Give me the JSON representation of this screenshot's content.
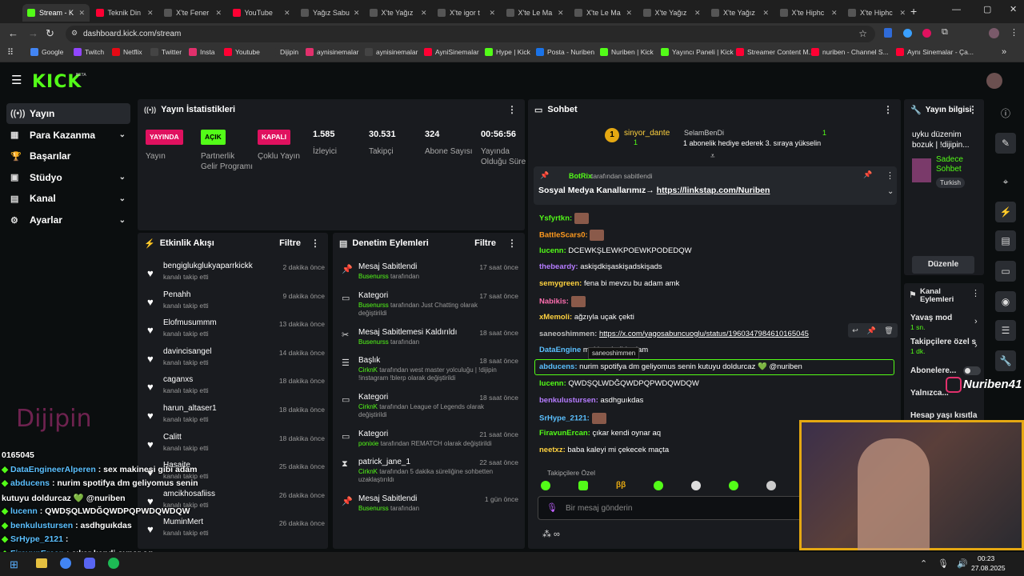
{
  "browser": {
    "tabs": [
      {
        "label": "Stream - K",
        "color": "#53fc18",
        "active": true
      },
      {
        "label": "Teknik Din",
        "color": "#ff0033"
      },
      {
        "label": "X'te Fener",
        "color": "#555"
      },
      {
        "label": "YouTube",
        "color": "#ff0033"
      },
      {
        "label": "Yağız Sabu",
        "color": "#555"
      },
      {
        "label": "X'te Yağız",
        "color": "#555"
      },
      {
        "label": "X'te igor t",
        "color": "#555"
      },
      {
        "label": "X'te Le Ma",
        "color": "#555"
      },
      {
        "label": "X'te Le Ma",
        "color": "#555"
      },
      {
        "label": "X'te Yağız",
        "color": "#555"
      },
      {
        "label": "X'te Yağız",
        "color": "#555"
      },
      {
        "label": "X'te Hiphc",
        "color": "#555"
      },
      {
        "label": "X'te Hiphc",
        "color": "#555"
      }
    ],
    "url": "dashboard.kick.com/stream",
    "bookmarks": [
      {
        "label": "Google",
        "color": "#4285f4"
      },
      {
        "label": "Twitch",
        "color": "#9146ff"
      },
      {
        "label": "Netflix",
        "color": "#e50914"
      },
      {
        "label": "Twitter",
        "color": "#444"
      },
      {
        "label": "Insta",
        "color": "#e1306c"
      },
      {
        "label": "Youtube",
        "color": "#ff0033"
      },
      {
        "label": "Dijipin",
        "color": "#333"
      },
      {
        "label": "aynisinemalar",
        "color": "#e1306c"
      },
      {
        "label": "aynisinemalar",
        "color": "#444"
      },
      {
        "label": "AyniSinemalar",
        "color": "#ff0033"
      },
      {
        "label": "Hype | Kick",
        "color": "#53fc18"
      },
      {
        "label": "Posta - Nuriben",
        "color": "#1a73e8"
      },
      {
        "label": "Nuriben | Kick",
        "color": "#53fc18"
      },
      {
        "label": "Yayıncı Paneli | Kick",
        "color": "#53fc18"
      },
      {
        "label": "Streamer Content M...",
        "color": "#ff0033"
      },
      {
        "label": "nuriben - Channel S...",
        "color": "#ff0033"
      },
      {
        "label": "Aynı Sinemalar - Ça...",
        "color": "#ff0033"
      }
    ]
  },
  "app": {
    "logo": "KICK",
    "beta": "BETA"
  },
  "sidebar": [
    {
      "label": "Yayın",
      "icon": "((•))",
      "chev": ""
    },
    {
      "label": "Para Kazanma",
      "icon": "▦",
      "chev": "⌄"
    },
    {
      "label": "Başarılar",
      "icon": "🏆",
      "chev": ""
    },
    {
      "label": "Stüdyo",
      "icon": "▣",
      "chev": "⌄"
    },
    {
      "label": "Kanal",
      "icon": "▤",
      "chev": "⌄"
    },
    {
      "label": "Ayarlar",
      "icon": "⚙",
      "chev": "⌄"
    }
  ],
  "stats": {
    "title": "Yayın İstatistikleri",
    "items": [
      {
        "badge": "YAYINDA",
        "badge_color": "#e0115f",
        "label": "Yayın"
      },
      {
        "badge": "AÇIK",
        "badge_color": "#53fc18",
        "label": "Partnerlik Gelir Programı"
      },
      {
        "badge": "KAPALI",
        "badge_color": "#e0115f",
        "label": "Çoklu Yayın"
      },
      {
        "num": "1.585",
        "label": "İzleyici"
      },
      {
        "num": "30.531",
        "label": "Takipçi"
      },
      {
        "num": "324",
        "label": "Abone Sayısı"
      },
      {
        "num": "00:56:56",
        "label": "Yayında Olduğu Süre"
      }
    ]
  },
  "events": {
    "title": "Etkinlik Akışı",
    "filter": "Filtre",
    "items": [
      {
        "name": "bengiglukglukyaparrkickk",
        "sub": "kanalı takip etti",
        "time": "2 dakika önce"
      },
      {
        "name": "Penahh",
        "sub": "kanalı takip etti",
        "time": "9 dakika önce"
      },
      {
        "name": "Elofmusummm",
        "sub": "kanalı takip etti",
        "time": "13 dakika önce"
      },
      {
        "name": "davincisangel",
        "sub": "kanalı takip etti",
        "time": "14 dakika önce"
      },
      {
        "name": "caganxs",
        "sub": "kanalı takip etti",
        "time": "18 dakika önce"
      },
      {
        "name": "harun_altaser1",
        "sub": "kanalı takip etti",
        "time": "18 dakika önce"
      },
      {
        "name": "Calitt",
        "sub": "kanalı takip etti",
        "time": "18 dakika önce"
      },
      {
        "name": "Hasaite",
        "sub": "kanalı takip etti",
        "time": "25 dakika önce"
      },
      {
        "name": "amcikhosafiiss",
        "sub": "kanalı takip etti",
        "time": "26 dakika önce"
      },
      {
        "name": "MuminMert",
        "sub": "kanalı takip etti",
        "time": "26 dakika önce"
      }
    ]
  },
  "moderation": {
    "title": "Denetim Eylemleri",
    "filter": "Filtre",
    "items": [
      {
        "icon": "📌",
        "title": "Mesaj Sabitlendi",
        "time": "17 saat önce",
        "user": "Busenurss",
        "desc": "tarafından"
      },
      {
        "icon": "▭",
        "title": "Kategori",
        "time": "17 saat önce",
        "user": "Busenurss",
        "desc": "tarafından Just Chatting olarak değiştirildi"
      },
      {
        "icon": "✂",
        "title": "Mesaj Sabitlemesi Kaldırıldı",
        "time": "18 saat önce",
        "user": "Busenurss",
        "desc": "tarafından"
      },
      {
        "icon": "☰",
        "title": "Başlık",
        "time": "18 saat önce",
        "user": "CirknK",
        "desc": "tarafından west master yolculuğu | !dijipin !instagram !blerp olarak değiştirildi"
      },
      {
        "icon": "▭",
        "title": "Kategori",
        "time": "18 saat önce",
        "user": "CirknK",
        "desc": "tarafından League of Legends olarak değiştirildi"
      },
      {
        "icon": "▭",
        "title": "Kategori",
        "time": "21 saat önce",
        "user": "ponixie",
        "desc": "tarafından REMATCH olarak değiştirildi"
      },
      {
        "icon": "⧗",
        "title": "patrick_jane_1",
        "time": "22 saat önce",
        "user": "CirknK",
        "desc": "tarafından 5 dakika süreliğine sohbetten uzaklaştırıldı"
      },
      {
        "icon": "📌",
        "title": "Mesaj Sabitlendi",
        "time": "1 gün önce",
        "user": "Busenurss",
        "desc": "tarafından"
      }
    ]
  },
  "chat": {
    "title": "Sohbet",
    "gift_user": "sinyor_dante",
    "gift_count": "1",
    "gift_user2": "SelamBenDi",
    "gift_count2": "1",
    "gift_text": "1 abonelik hediye ederek 3. sıraya yükselin",
    "pinned_by": "BotRix",
    "pinned_by_suffix": "tarafından sabitlendi",
    "pinned_text": "Sosyal Medya Kanallarımız→ ",
    "pinned_link": "https://linkstap.com/Nuriben",
    "messages": [
      {
        "user": "Ysfyrtkn:",
        "color": "#53fc18",
        "text": "",
        "emote": true
      },
      {
        "user": "BattleScars0:",
        "color": "#ff9a1f",
        "text": "",
        "emote": true
      },
      {
        "user": "lucenn:",
        "color": "#53fc18",
        "text": "DCEWKŞLEWKPOEWKPODEDQW"
      },
      {
        "user": "thebeardy:",
        "color": "#b57cff",
        "text": "askişdkişaskişadskişads"
      },
      {
        "user": "semygreen:",
        "color": "#ffd23f",
        "text": "fena bi mevzu bu adam amk"
      },
      {
        "user": "Nabikis:",
        "color": "#ff6fb0",
        "text": "",
        "emote": true
      },
      {
        "user": "xMemoli:",
        "color": "#ffd23f",
        "text": "ağzıyla uçak çekti"
      },
      {
        "user": "saneoshimmen:",
        "color": "#bbb",
        "text": "https://x.com/yagosabuncuoglu/status/1960347984610165045"
      },
      {
        "user": "DataEngine",
        "color": "#5bc0ff",
        "text": "makinesi gibi adam"
      },
      {
        "user": "abducens:",
        "color": "#5bc0ff",
        "text": "nurim spotifya dm geliyomus senin kutuyu doldurcaz 💚 @nuriben"
      },
      {
        "user": "lucenn:",
        "color": "#53fc18",
        "text": "QWDŞQLWDĞQWDPQPWDQWDQW"
      },
      {
        "user": "benkulustursen:",
        "color": "#b57cff",
        "text": "asdhguıkdas"
      },
      {
        "user": "SrHype_2121:",
        "color": "#5bc0ff",
        "text": "",
        "emote": true
      },
      {
        "user": "FiravunErcan:",
        "color": "#53fc18",
        "text": "çıkar kendi oynar aq"
      },
      {
        "user": "neetxz:",
        "color": "#ffd23f",
        "text": "baba kaleyi mi çekecek maçta"
      }
    ],
    "tooltip": "saneoshimmen",
    "followers_label": "Takipçilere Özel",
    "input_placeholder": "Bir mesaj gönderin"
  },
  "streaminfo": {
    "title": "Yayın bilgisi",
    "stream_title": "uyku düzenim bozuk | !dijipin...",
    "category": "Sadece Sohbet",
    "lang": "Turkish",
    "edit": "Düzenle"
  },
  "channel_actions": {
    "title": "Kanal Eylemleri",
    "slow": "Yavaş mod",
    "slow_val": "1 sn.",
    "followers": "Takipçilere özel s",
    "followers_val": "1 dk.",
    "subs": "Abonelere...",
    "only": "Yalnızca...",
    "age": "Hesap yaşı kısıtla"
  },
  "overlay": {
    "brand": "Dijipin",
    "handle": "Nuriben41",
    "lines": [
      {
        "user": "",
        "text": "0165045"
      },
      {
        "user": "DataEngineerAlperen",
        "text": ": sex makinesi gibi adam"
      },
      {
        "user": "abducens",
        "text": ": nurim spotifya dm geliyomus senin"
      },
      {
        "user": "",
        "text": "kutuyu doldurcaz 💚 @nuriben"
      },
      {
        "user": "lucenn",
        "text": ": QWDŞQLWDĞQWDPQPWDQWDQW"
      },
      {
        "user": "benkulustursen",
        "text": ": asdhguıkdas"
      },
      {
        "user": "SrHype_2121",
        "text": ":"
      },
      {
        "user": "FiravunErcan",
        "text": ": çıkar kendi oynar aq"
      },
      {
        "user": "neetxz",
        "text": ": baba kaleyi mi çekecek maçta"
      }
    ]
  },
  "taskbar": {
    "time": "00:23",
    "date": "27.08.2025"
  }
}
